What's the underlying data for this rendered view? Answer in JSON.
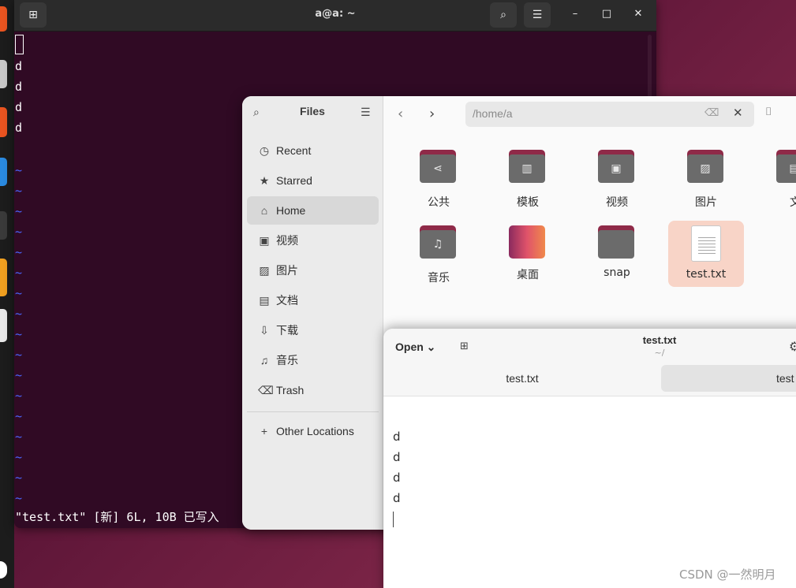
{
  "dock": {
    "colors": [
      "#e95420",
      "#f0a020",
      "#2a8ae0",
      "#ffffff"
    ]
  },
  "terminal": {
    "title": "a@a: ~",
    "new_tab_icon": "new-tab-icon",
    "search_icon": "search-icon",
    "menu_icon": "hamburger-icon",
    "minimize": "–",
    "maximize": "□",
    "close": "✕",
    "lines": [
      "d",
      "d",
      "d",
      "d"
    ],
    "tilde": "~",
    "status_line": "\"test.txt\" [新] 6L, 10B 已写入"
  },
  "files": {
    "title": "Files",
    "sidebar": [
      {
        "label": "Recent",
        "icon": "clock-icon",
        "glyph": "◷"
      },
      {
        "label": "Starred",
        "icon": "star-icon",
        "glyph": "★"
      },
      {
        "label": "Home",
        "icon": "home-icon",
        "glyph": "⌂",
        "active": true
      },
      {
        "label": "视频",
        "icon": "film-icon",
        "glyph": "▣"
      },
      {
        "label": "图片",
        "icon": "image-icon",
        "glyph": "▨"
      },
      {
        "label": "文档",
        "icon": "document-icon",
        "glyph": "▤"
      },
      {
        "label": "下载",
        "icon": "download-icon",
        "glyph": "⇩"
      },
      {
        "label": "音乐",
        "icon": "music-icon",
        "glyph": "♫"
      },
      {
        "label": "Trash",
        "icon": "trash-icon",
        "glyph": "⌫"
      }
    ],
    "other_locations": "Other Locations",
    "path": "/home/a",
    "items": [
      {
        "name": "公共",
        "kind": "folder",
        "glyph": "⋖"
      },
      {
        "name": "模板",
        "kind": "folder",
        "glyph": "▥"
      },
      {
        "name": "视频",
        "kind": "folder",
        "glyph": "▣"
      },
      {
        "name": "图片",
        "kind": "folder",
        "glyph": "▨"
      },
      {
        "name": "文",
        "kind": "folder",
        "glyph": "▤"
      },
      {
        "name": "音乐",
        "kind": "folder",
        "glyph": "♫"
      },
      {
        "name": "桌面",
        "kind": "desktop",
        "glyph": ""
      },
      {
        "name": "snap",
        "kind": "folder",
        "glyph": ""
      },
      {
        "name": "test.txt",
        "kind": "file",
        "glyph": "",
        "selected": true
      }
    ]
  },
  "editor": {
    "open_label": "Open",
    "title": "test.txt",
    "subtitle": "~/",
    "tabs": [
      "test.txt",
      "test"
    ],
    "lines": [
      "d",
      "d",
      "d",
      "d"
    ]
  },
  "watermark": "CSDN @一然明月"
}
